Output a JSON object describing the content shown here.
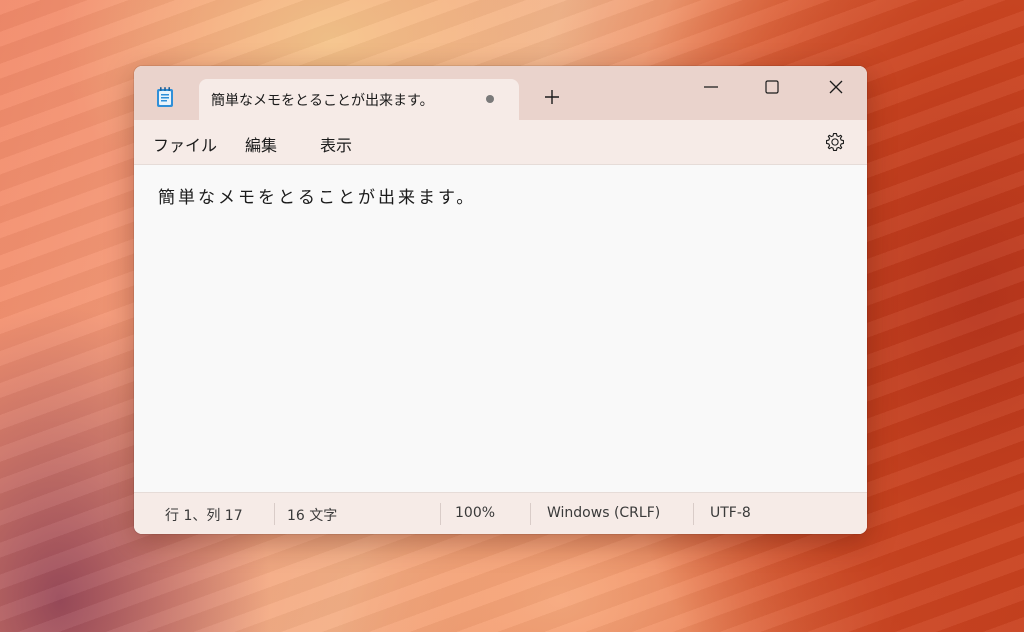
{
  "tab": {
    "title": "簡単なメモをとることが出来ます。",
    "new_tab_label": "+"
  },
  "menu": {
    "file": "ファイル",
    "edit": "編集",
    "view": "表示"
  },
  "editor": {
    "content": "簡単なメモをとることが出来ます。"
  },
  "status": {
    "position": "行 1、列 17",
    "char_count": "16 文字",
    "zoom": "100%",
    "line_ending": "Windows (CRLF)",
    "encoding": "UTF-8"
  },
  "icons": {
    "app": "notepad-icon",
    "unsaved": "unsaved-dot-icon",
    "minimize": "minimize-icon",
    "maximize": "maximize-icon",
    "close": "close-icon",
    "settings": "gear-icon"
  }
}
